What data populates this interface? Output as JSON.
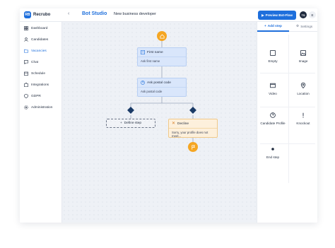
{
  "app": {
    "logo_text": "Recrubo",
    "logo_mark": "RB"
  },
  "header": {
    "bot_title": "Bot Studio",
    "subtitle": "New business developer",
    "preview_button": "Preview Bot-Flow",
    "avatar_initials": "TS",
    "language": "E"
  },
  "sidebar": {
    "items": [
      {
        "label": "Dashboard",
        "icon": "dashboard-icon"
      },
      {
        "label": "Candidates",
        "icon": "user-icon"
      },
      {
        "label": "Vacancies",
        "icon": "folder-icon",
        "active": true
      },
      {
        "label": "Chat",
        "icon": "chat-icon"
      },
      {
        "label": "Schedule",
        "icon": "calendar-icon"
      },
      {
        "label": "Integrations",
        "icon": "puzzle-icon"
      },
      {
        "label": "GDPR",
        "icon": "shield-icon"
      },
      {
        "label": "Administration",
        "icon": "gear-icon"
      }
    ]
  },
  "panel": {
    "tab_add": "Add step",
    "tab_settings": "Settings",
    "steps": [
      {
        "label": "Empty",
        "icon": "square-icon"
      },
      {
        "label": "Image",
        "icon": "image-icon"
      },
      {
        "label": "Video",
        "icon": "video-icon"
      },
      {
        "label": "Location",
        "icon": "location-icon"
      },
      {
        "label": "Candidate Profile",
        "icon": "question-icon"
      },
      {
        "label": "Knockout",
        "icon": "exclamation-icon"
      },
      {
        "label": "End step",
        "icon": "dot-icon"
      }
    ]
  },
  "flow": {
    "node1_title": "First name",
    "node1_body": "Ask first name",
    "node2_title": "Ask postal code",
    "node2_body": "Ask postal code",
    "define_step": "Define step",
    "decline_title": "Decline",
    "decline_body": "Sorry, your profile does not meet...",
    "colors": {
      "accent": "#1e6fdc",
      "start": "#f5a623",
      "node": "#d9e6fb",
      "decline": "#fdf0dc",
      "diamond": "#1a3a66"
    }
  }
}
